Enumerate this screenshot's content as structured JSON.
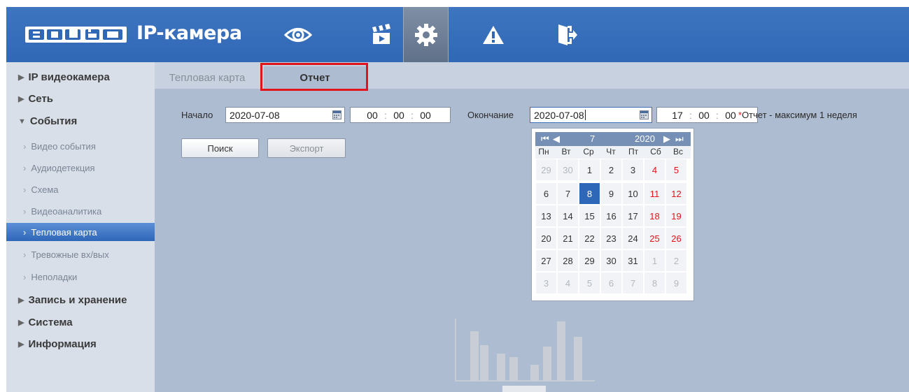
{
  "header": {
    "logo_text": "BOLID",
    "app_title": "IP-камера",
    "nav_icons": [
      "eye-icon",
      "clapperboard-icon",
      "gear-icon",
      "warning-icon",
      "logout-icon"
    ],
    "active_nav": "gear-icon"
  },
  "sidebar": {
    "sections": [
      {
        "label": "IP видеокамера",
        "expanded": false
      },
      {
        "label": "Сеть",
        "expanded": false
      },
      {
        "label": "События",
        "expanded": true
      },
      {
        "label": "Запись и хранение",
        "expanded": false
      },
      {
        "label": "Система",
        "expanded": false
      },
      {
        "label": "Информация",
        "expanded": false
      }
    ],
    "event_items": [
      {
        "label": "Видео события"
      },
      {
        "label": "Аудиодетекция"
      },
      {
        "label": "Схема"
      },
      {
        "label": "Видеоаналитика"
      },
      {
        "label": "Тепловая карта",
        "active": true
      },
      {
        "label": "Тревожные вх/вых"
      },
      {
        "label": "Неполадки"
      }
    ]
  },
  "tabs": {
    "heatmap_label": "Тепловая карта",
    "report_label": "Отчет",
    "active": "Отчет"
  },
  "form": {
    "start_label": "Начало",
    "start_date": "2020-07-08",
    "start_time": {
      "h": "00",
      "m": "00",
      "s": "00"
    },
    "end_label": "Окончание",
    "end_date": "2020-07-08",
    "end_time": {
      "h": "17",
      "m": "00",
      "s": "00"
    },
    "note_star": "*",
    "note_text": "Отчет - максимум 1 неделя",
    "search_label": "Поиск",
    "export_label": "Экспорт"
  },
  "calendar": {
    "month": "7",
    "year": "2020",
    "weekdays": [
      "Пн",
      "Вт",
      "Ср",
      "Чт",
      "Пт",
      "Сб",
      "Вс"
    ],
    "weeks": [
      [
        "29",
        "30",
        "1",
        "2",
        "3",
        "4",
        "5"
      ],
      [
        "6",
        "7",
        "8",
        "9",
        "10",
        "11",
        "12"
      ],
      [
        "13",
        "14",
        "15",
        "16",
        "17",
        "18",
        "19"
      ],
      [
        "20",
        "21",
        "22",
        "23",
        "24",
        "25",
        "26"
      ],
      [
        "27",
        "28",
        "29",
        "30",
        "31",
        "1",
        "2"
      ],
      [
        "3",
        "4",
        "5",
        "6",
        "7",
        "8",
        "9"
      ]
    ],
    "selected_day": "8"
  },
  "colors": {
    "header": "#3168b6",
    "content_bg": "#aebcd1",
    "sidebar_bg": "#d8dfe9",
    "highlight_red": "#e0151c",
    "weekend": "#e0151c",
    "selected": "#2f67b8"
  }
}
